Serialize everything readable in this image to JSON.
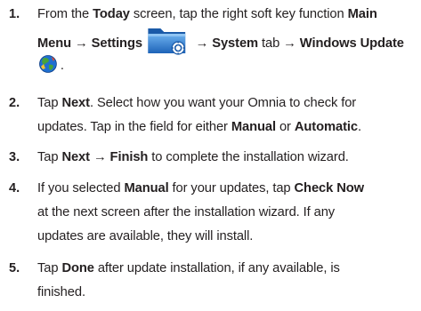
{
  "steps": [
    {
      "number": "1.",
      "parts": {
        "a": "From the ",
        "today": "Today",
        "b": " screen, tap the right soft key function ",
        "main": "Main",
        "menu_settings": "Menu → Settings",
        "system": "→ System",
        "tab": " tab → ",
        "windows_update": "Windows Update",
        "period": "."
      },
      "icons": [
        "settings-folder-icon",
        "windows-update-globe-icon"
      ]
    },
    {
      "number": "2.",
      "parts": {
        "a": "Tap ",
        "next": "Next",
        "b": ". Select how you want your Omnia to check for",
        "c": "updates. Tap in the field for either ",
        "manual": "Manual",
        "or": " or ",
        "automatic": "Automatic",
        "period": "."
      }
    },
    {
      "number": "3.",
      "parts": {
        "a": "Tap ",
        "next_finish": "Next → Finish",
        "b": " to complete the installation wizard."
      }
    },
    {
      "number": "4.",
      "parts": {
        "a": "If you selected ",
        "manual": "Manual",
        "b": " for your updates, tap ",
        "check_now": "Check Now",
        "c": "at the next screen after the installation wizard. If any",
        "d": "updates are available, they will install."
      }
    },
    {
      "number": "5.",
      "parts": {
        "a": "Tap ",
        "done": "Done",
        "b": " after update installation, if any available, is",
        "c": "finished."
      }
    }
  ],
  "colors": {
    "text": "#231f20",
    "folder_blue": "#2a7fd4",
    "globe_blue": "#1f6fd1",
    "globe_green": "#47a33b"
  }
}
